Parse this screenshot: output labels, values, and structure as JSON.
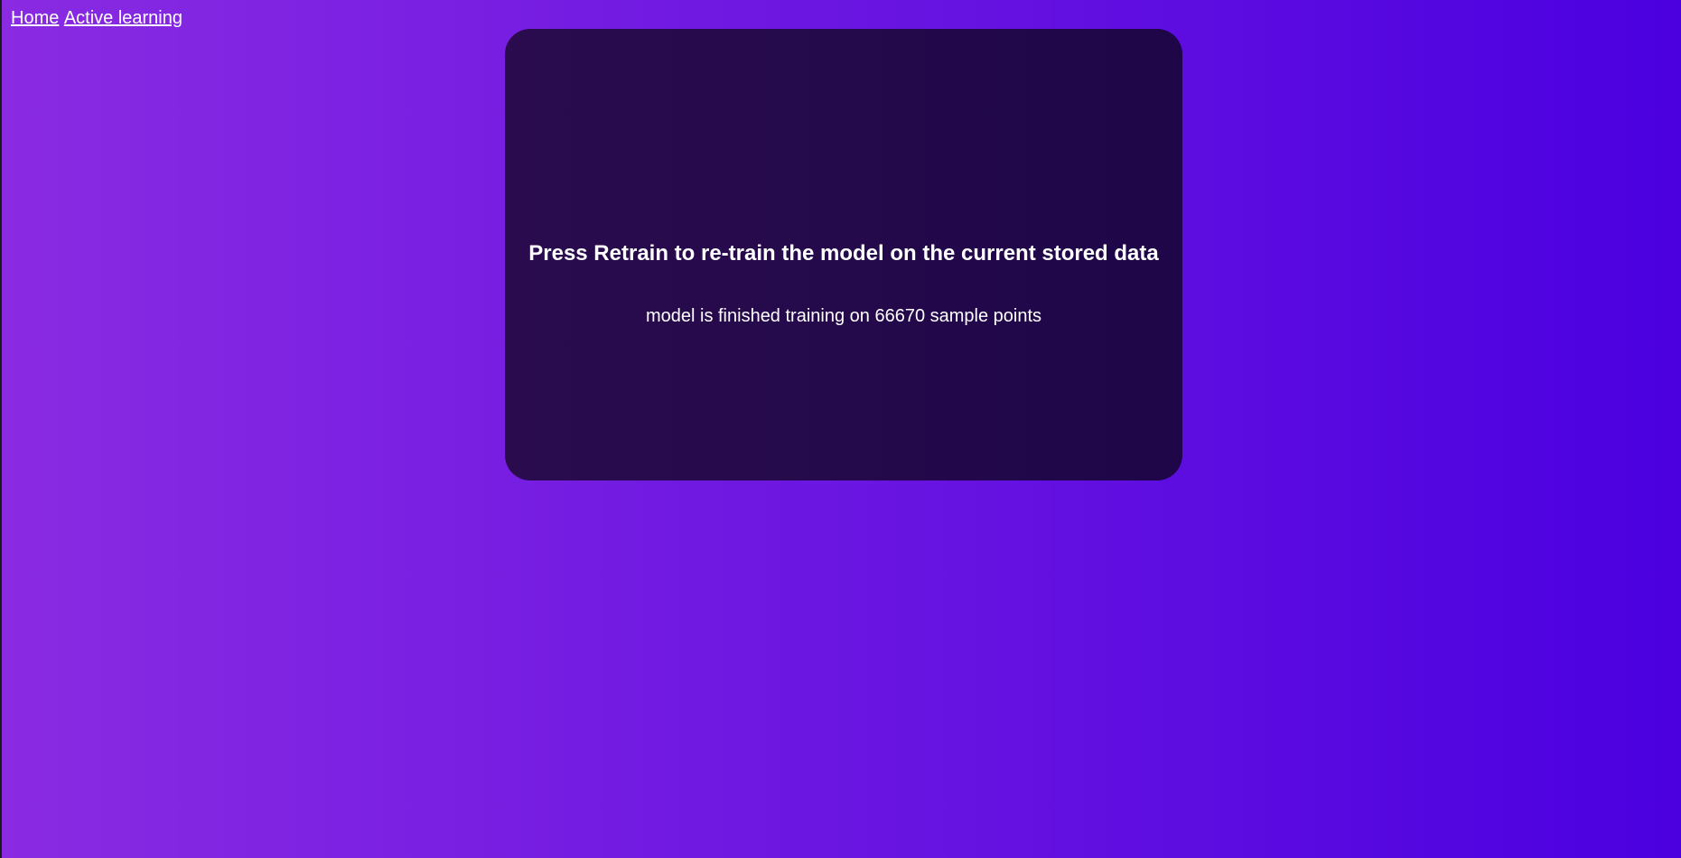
{
  "nav": {
    "home_label": "Home",
    "active_learning_label": "Active learning"
  },
  "card": {
    "title": "Press Retrain to re-train the model on the current stored data",
    "status": "model is finished training on 66670 sample points"
  },
  "colors": {
    "background_start": "#8a2be2",
    "background_end": "#4b00e0",
    "card_start": "#2a0c4e",
    "card_end": "#1e0648",
    "text": "#ffffff"
  }
}
